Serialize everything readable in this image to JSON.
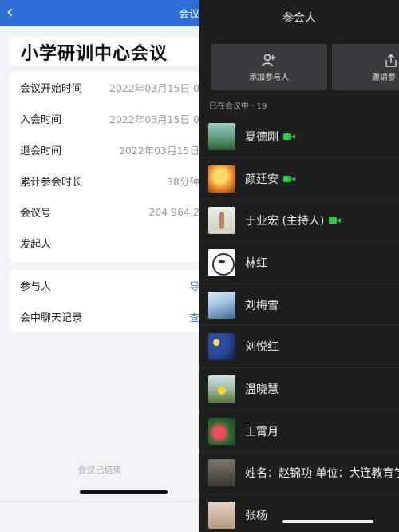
{
  "left": {
    "header_title": "会议详情",
    "meeting_title": "小学研训中心会议",
    "details": [
      {
        "label": "会议开始时间",
        "value": "2022年03月15日 0"
      },
      {
        "label": "入会时间",
        "value": "2022年03月15日 0"
      },
      {
        "label": "退会时间",
        "value": "2022年03月15日"
      },
      {
        "label": "累计参会时长",
        "value": "38分钟"
      },
      {
        "label": "会议号",
        "value": "204 964 2"
      },
      {
        "label": "发起人",
        "value": ""
      }
    ],
    "links": [
      {
        "label": "参与人",
        "value": "导"
      },
      {
        "label": "会中聊天记录",
        "value": "查"
      }
    ],
    "ended_text": "会议已结束"
  },
  "right": {
    "title": "参会人",
    "actions": [
      {
        "label": "添加参与人",
        "icon": "add-person-icon"
      },
      {
        "label": "邀请参",
        "icon": "share-icon"
      }
    ],
    "in_meeting_label": "已在会议中 · 19",
    "participants": [
      {
        "name": "夏德刚",
        "video": true
      },
      {
        "name": "颜廷安",
        "video": true
      },
      {
        "name": "于业宏 (主持人)",
        "video": true
      },
      {
        "name": "林红",
        "video": false
      },
      {
        "name": "刘梅雪",
        "video": false
      },
      {
        "name": "刘悦红",
        "video": false
      },
      {
        "name": "温晓慧",
        "video": false
      },
      {
        "name": "王霄月",
        "video": false
      },
      {
        "name": "姓名：赵锦功 单位：大连教育学",
        "video": false
      },
      {
        "name": "张杨",
        "video": false
      }
    ],
    "colors": {
      "video_icon": "#2ecb45",
      "panel_bg": "#1e1e1e"
    }
  },
  "colors": {
    "header_blue": "#2d6fd6"
  }
}
